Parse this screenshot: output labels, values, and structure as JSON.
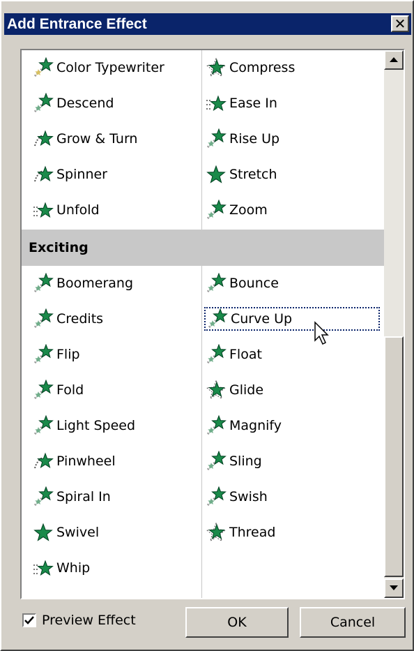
{
  "window": {
    "title": "Add Entrance Effect",
    "close_glyph": "✕"
  },
  "list": {
    "rows_top": [
      {
        "left": {
          "label": "Color Typewriter",
          "icon": "star-color-typewriter-icon"
        },
        "right": {
          "label": "Compress",
          "icon": "star-compress-icon"
        }
      },
      {
        "left": {
          "label": "Descend",
          "icon": "star-motion-icon"
        },
        "right": {
          "label": "Ease In",
          "icon": "star-ease-in-icon"
        }
      },
      {
        "left": {
          "label": "Grow & Turn",
          "icon": "star-spin-icon"
        },
        "right": {
          "label": "Rise Up",
          "icon": "star-motion-icon"
        }
      },
      {
        "left": {
          "label": "Spinner",
          "icon": "star-spin-icon"
        },
        "right": {
          "label": "Stretch",
          "icon": "star-solid-icon"
        }
      },
      {
        "left": {
          "label": "Unfold",
          "icon": "star-ease-in-icon"
        },
        "right": {
          "label": "Zoom",
          "icon": "star-motion-icon"
        }
      }
    ],
    "category": "Exciting",
    "rows_exciting": [
      {
        "left": {
          "label": "Boomerang",
          "icon": "star-motion-icon"
        },
        "right": {
          "label": "Bounce",
          "icon": "star-motion-icon"
        }
      },
      {
        "left": {
          "label": "Credits",
          "icon": "star-motion-icon"
        },
        "right": {
          "label": "Curve Up",
          "icon": "star-motion-icon",
          "focused": true
        }
      },
      {
        "left": {
          "label": "Flip",
          "icon": "star-motion-icon"
        },
        "right": {
          "label": "Float",
          "icon": "star-motion-icon"
        }
      },
      {
        "left": {
          "label": "Fold",
          "icon": "star-motion-icon"
        },
        "right": {
          "label": "Glide",
          "icon": "star-compress-icon"
        }
      },
      {
        "left": {
          "label": "Light Speed",
          "icon": "star-motion-icon"
        },
        "right": {
          "label": "Magnify",
          "icon": "star-motion-icon"
        }
      },
      {
        "left": {
          "label": "Pinwheel",
          "icon": "star-spin-icon"
        },
        "right": {
          "label": "Sling",
          "icon": "star-motion-icon"
        }
      },
      {
        "left": {
          "label": "Spiral In",
          "icon": "star-motion-icon"
        },
        "right": {
          "label": "Swish",
          "icon": "star-motion-icon"
        }
      },
      {
        "left": {
          "label": "Swivel",
          "icon": "star-solid-icon"
        },
        "right": {
          "label": "Thread",
          "icon": "star-compress-icon"
        }
      },
      {
        "left": {
          "label": "Whip",
          "icon": "star-ease-in-icon"
        },
        "right": null
      }
    ]
  },
  "footer": {
    "preview_label": "Preview Effect",
    "preview_checked": true,
    "ok_label": "OK",
    "cancel_label": "Cancel"
  },
  "colors": {
    "titlebar": "#0a246a",
    "star_green": "#1a8a4a",
    "star_dark": "#004020",
    "dialog_bg": "#d4d0c8",
    "category_bg": "#c8c8c8"
  }
}
